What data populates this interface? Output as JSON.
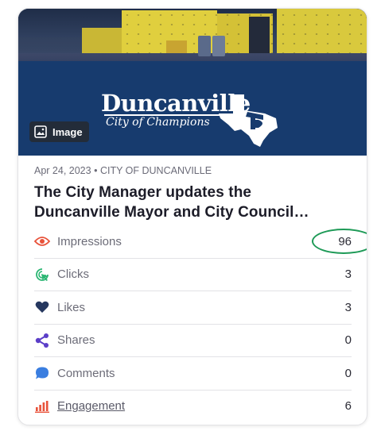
{
  "post": {
    "media_badge": "Image",
    "logo_title": "Duncanville",
    "logo_subtitle": "City of Champions",
    "date": "Apr 24, 2023",
    "separator": "•",
    "account": "CITY OF DUNCANVILLE",
    "title_line1": "The City Manager updates the",
    "title_line2": "Duncanville Mayor and City Council…"
  },
  "stats": [
    {
      "label": "Impressions",
      "value": "96",
      "icon": "eye-icon",
      "color": "#e8523a"
    },
    {
      "label": "Clicks",
      "value": "3",
      "icon": "cursor-click-icon",
      "color": "#2bb673"
    },
    {
      "label": "Likes",
      "value": "3",
      "icon": "heart-icon",
      "color": "#26385f"
    },
    {
      "label": "Shares",
      "value": "0",
      "icon": "share-icon",
      "color": "#5b3ec8"
    },
    {
      "label": "Comments",
      "value": "0",
      "icon": "comment-icon",
      "color": "#3a7ee0"
    },
    {
      "label": "Engagement",
      "value": "6",
      "icon": "bar-chart-icon",
      "color": "#e8523a"
    }
  ],
  "colors": {
    "highlight_circle": "#1e9a57",
    "hero_blue": "#173b6e"
  }
}
